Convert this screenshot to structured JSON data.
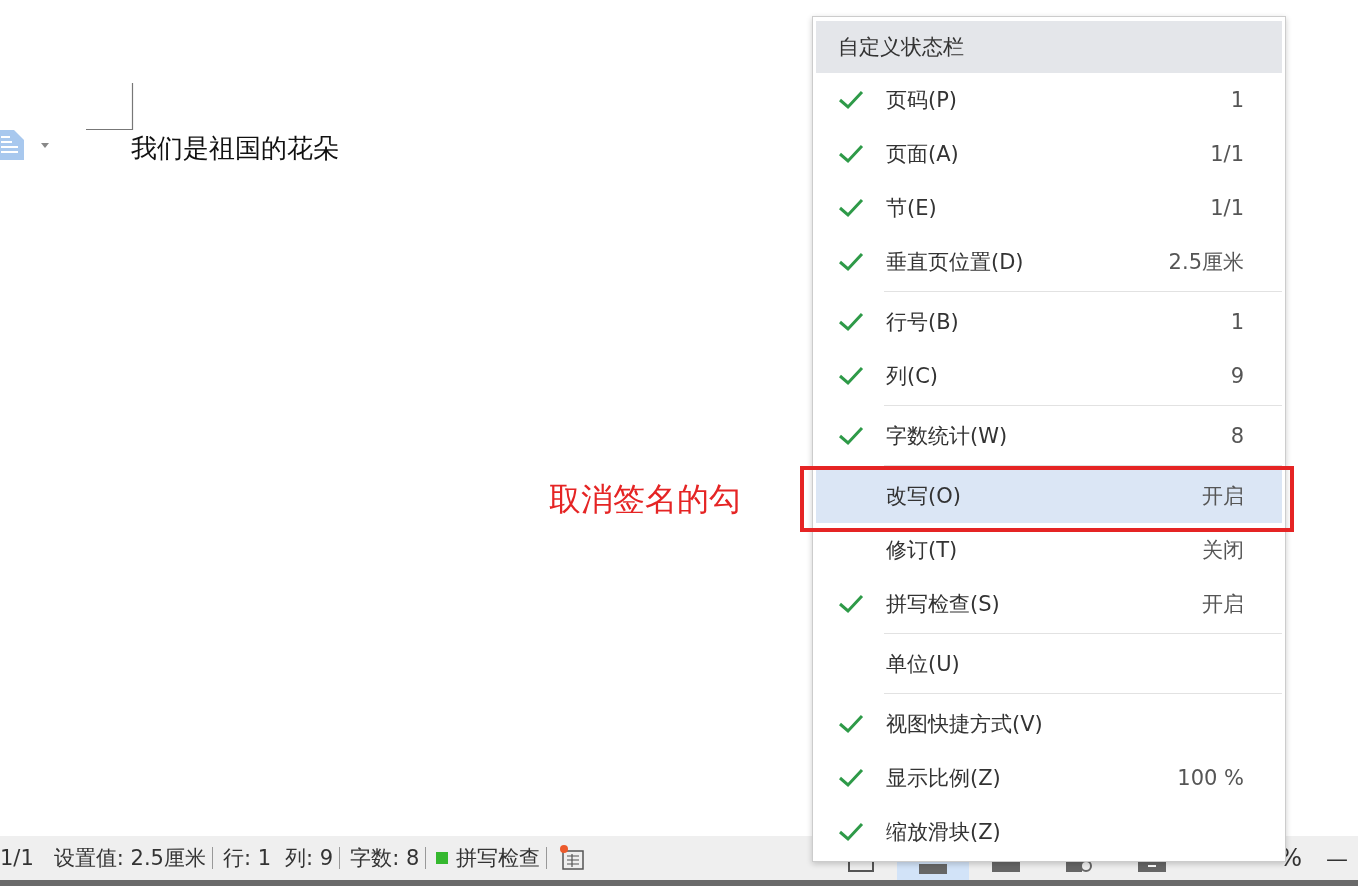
{
  "document": {
    "text": "我们是祖国的花朵"
  },
  "menu": {
    "title": "自定义状态栏",
    "groups": [
      {
        "items": [
          {
            "label": "页码(P)",
            "value": "1",
            "checked": true,
            "selected": false
          },
          {
            "label": "页面(A)",
            "value": "1/1",
            "checked": true,
            "selected": false
          },
          {
            "label": "节(E)",
            "value": "1/1",
            "checked": true,
            "selected": false
          },
          {
            "label": "垂直页位置(D)",
            "value": "2.5厘米",
            "checked": true,
            "selected": false
          }
        ]
      },
      {
        "items": [
          {
            "label": "行号(B)",
            "value": "1",
            "checked": true,
            "selected": false
          },
          {
            "label": "列(C)",
            "value": "9",
            "checked": true,
            "selected": false
          }
        ]
      },
      {
        "items": [
          {
            "label": "字数统计(W)",
            "value": "8",
            "checked": true,
            "selected": false
          }
        ]
      },
      {
        "items": [
          {
            "label": "改写(O)",
            "value": "开启",
            "checked": false,
            "selected": true
          },
          {
            "label": "修订(T)",
            "value": "关闭",
            "checked": false,
            "selected": false
          },
          {
            "label": "拼写检查(S)",
            "value": "开启",
            "checked": true,
            "selected": false
          }
        ]
      },
      {
        "items": [
          {
            "label": "单位(U)",
            "checked": false,
            "selected": false
          }
        ]
      },
      {
        "items": [
          {
            "label": "视图快捷方式(V)",
            "checked": true,
            "selected": false
          },
          {
            "label": "显示比例(Z)",
            "value": "100 %",
            "checked": true,
            "selected": false
          },
          {
            "label": "缩放滑块(Z)",
            "checked": true,
            "selected": false
          }
        ]
      }
    ]
  },
  "annotation": {
    "text": "取消签名的勾"
  },
  "status_bar": {
    "page": "1/1",
    "setting": "设置值: 2.5厘米",
    "line": "行: 1",
    "column": "列: 9",
    "word_count": "字数: 8",
    "spell_check": "拼写检查",
    "zoom_percent": "%",
    "zoom_out": "—"
  }
}
